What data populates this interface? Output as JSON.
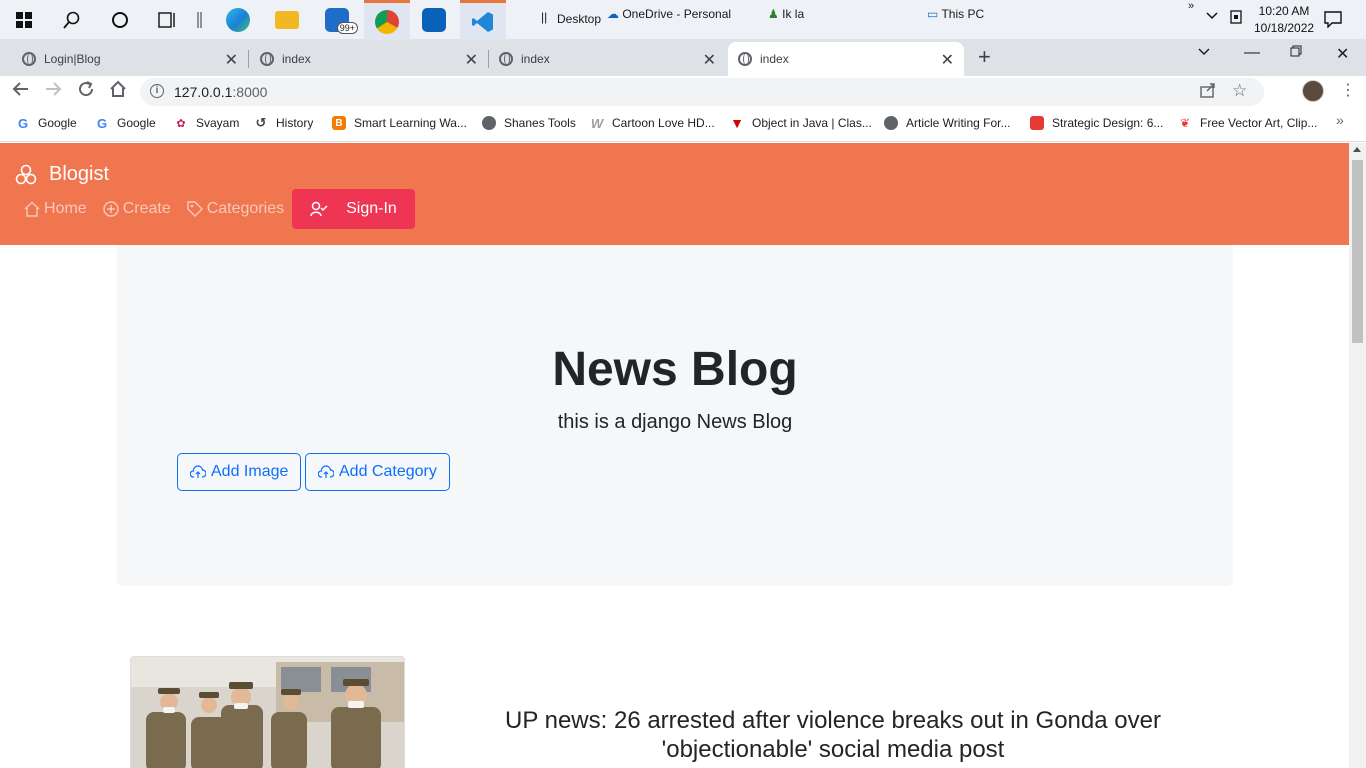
{
  "taskbar": {
    "desktop_label": "Desktop",
    "onedrive_label": "OneDrive - Personal",
    "user_label": "Ik la",
    "thispc_label": "This PC",
    "mail_badge": "99+",
    "time": "10:20 AM",
    "date": "10/18/2022"
  },
  "browser": {
    "tabs": [
      {
        "title": "Login|Blog"
      },
      {
        "title": "index"
      },
      {
        "title": "index"
      },
      {
        "title": "index"
      }
    ],
    "url_host": "127.0.0.1",
    "url_port": ":8000",
    "bookmarks": [
      {
        "label": "Google",
        "icon": "google-icon"
      },
      {
        "label": "Google",
        "icon": "google-icon"
      },
      {
        "label": "Svayam",
        "icon": "svayam-icon"
      },
      {
        "label": "History",
        "icon": "history-icon"
      },
      {
        "label": "Smart Learning Wa...",
        "icon": "blogger-icon"
      },
      {
        "label": "Shanes Tools",
        "icon": "globe-icon"
      },
      {
        "label": "Cartoon Love HD...",
        "icon": "w-icon"
      },
      {
        "label": "Object in Java | Clas...",
        "icon": "v-icon"
      },
      {
        "label": "Article Writing For...",
        "icon": "globe-icon"
      },
      {
        "label": "Strategic Design: 6...",
        "icon": "strategic-icon"
      },
      {
        "label": "Free Vector Art, Clip...",
        "icon": "vector-icon"
      }
    ]
  },
  "site": {
    "brand": "Blogist",
    "nav": {
      "home": "Home",
      "create": "Create",
      "categories": "Categories",
      "signin": "Sign-In"
    },
    "hero": {
      "title": "News Blog",
      "subtitle": "this is a django News Blog",
      "add_image": "Add Image",
      "add_category": "Add Category"
    },
    "posts": [
      {
        "title": "UP news: 26 arrested after violence breaks out in Gonda over 'objectionable' social media post"
      }
    ]
  },
  "colors": {
    "nav_bg": "#f07650",
    "signin_bg": "#ee3554",
    "primary": "#0d6efd"
  }
}
